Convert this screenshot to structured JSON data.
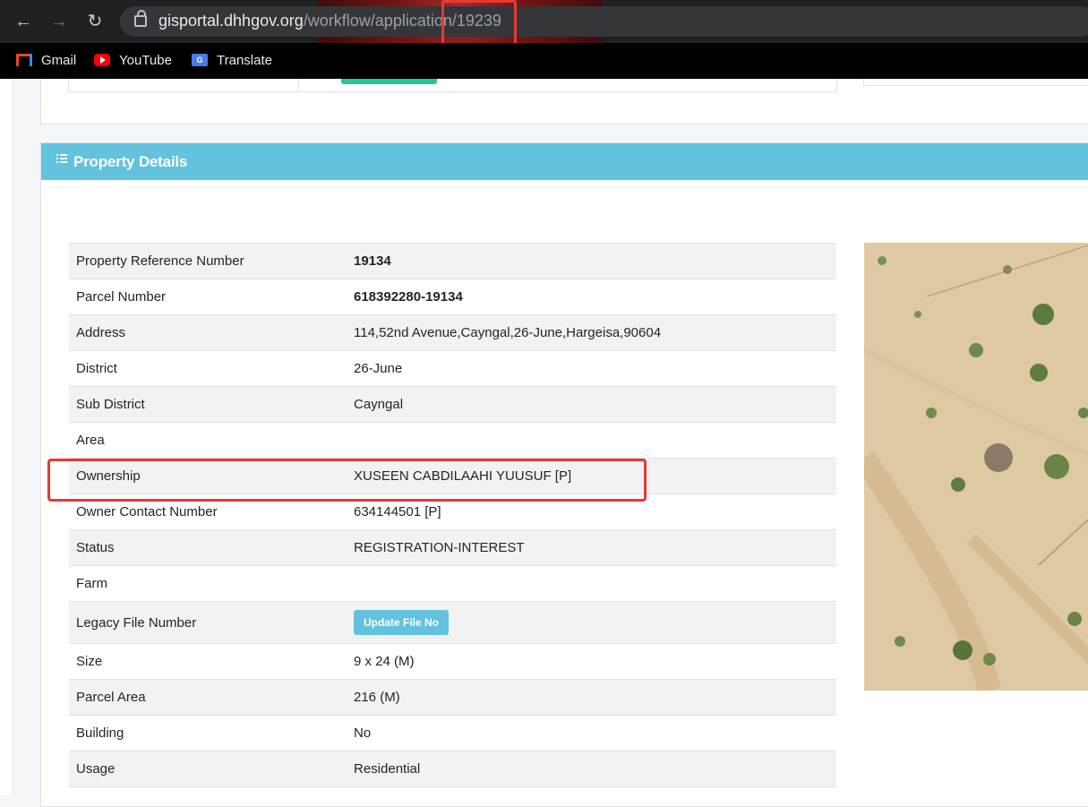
{
  "browser": {
    "url_host": "gisportal.dhhgov.org",
    "url_path_prefix": "/workflow/applica",
    "url_path_mid": "tion/",
    "url_path_id": "19239",
    "bookmarks": [
      {
        "label": "Gmail",
        "icon": "gmail-icon"
      },
      {
        "label": "YouTube",
        "icon": "youtube-icon"
      },
      {
        "label": "Translate",
        "icon": "translate-icon"
      }
    ]
  },
  "card": {
    "title": "Property Details",
    "header_color": "#63c2de"
  },
  "details": {
    "rows": [
      {
        "label": "Property Reference Number",
        "value": "19134"
      },
      {
        "label": "Parcel Number",
        "value": "618392280-19134"
      },
      {
        "label": "Address",
        "value": "114,52nd Avenue,Cayngal,26-June,Hargeisa,90604"
      },
      {
        "label": "District",
        "value": "26-June"
      },
      {
        "label": "Sub District",
        "value": "Cayngal"
      },
      {
        "label": "Area",
        "value": ""
      },
      {
        "label": "Ownership",
        "value": "XUSEEN CABDILAAHI YUUSUF [P]"
      },
      {
        "label": "Owner Contact Number",
        "value": "634144501 [P]"
      },
      {
        "label": "Status",
        "value": "REGISTRATION-INTEREST"
      },
      {
        "label": "Farm",
        "value": ""
      },
      {
        "label": "Legacy File Number",
        "button": "Update File No"
      },
      {
        "label": "Size",
        "value": "9 x 24 (M)"
      },
      {
        "label": "Parcel Area",
        "value": "216 (M)"
      },
      {
        "label": "Building",
        "value": "No"
      },
      {
        "label": "Usage",
        "value": "Residential"
      }
    ]
  },
  "colors": {
    "highlight": "#e53935",
    "accent_green": "#20c997"
  }
}
